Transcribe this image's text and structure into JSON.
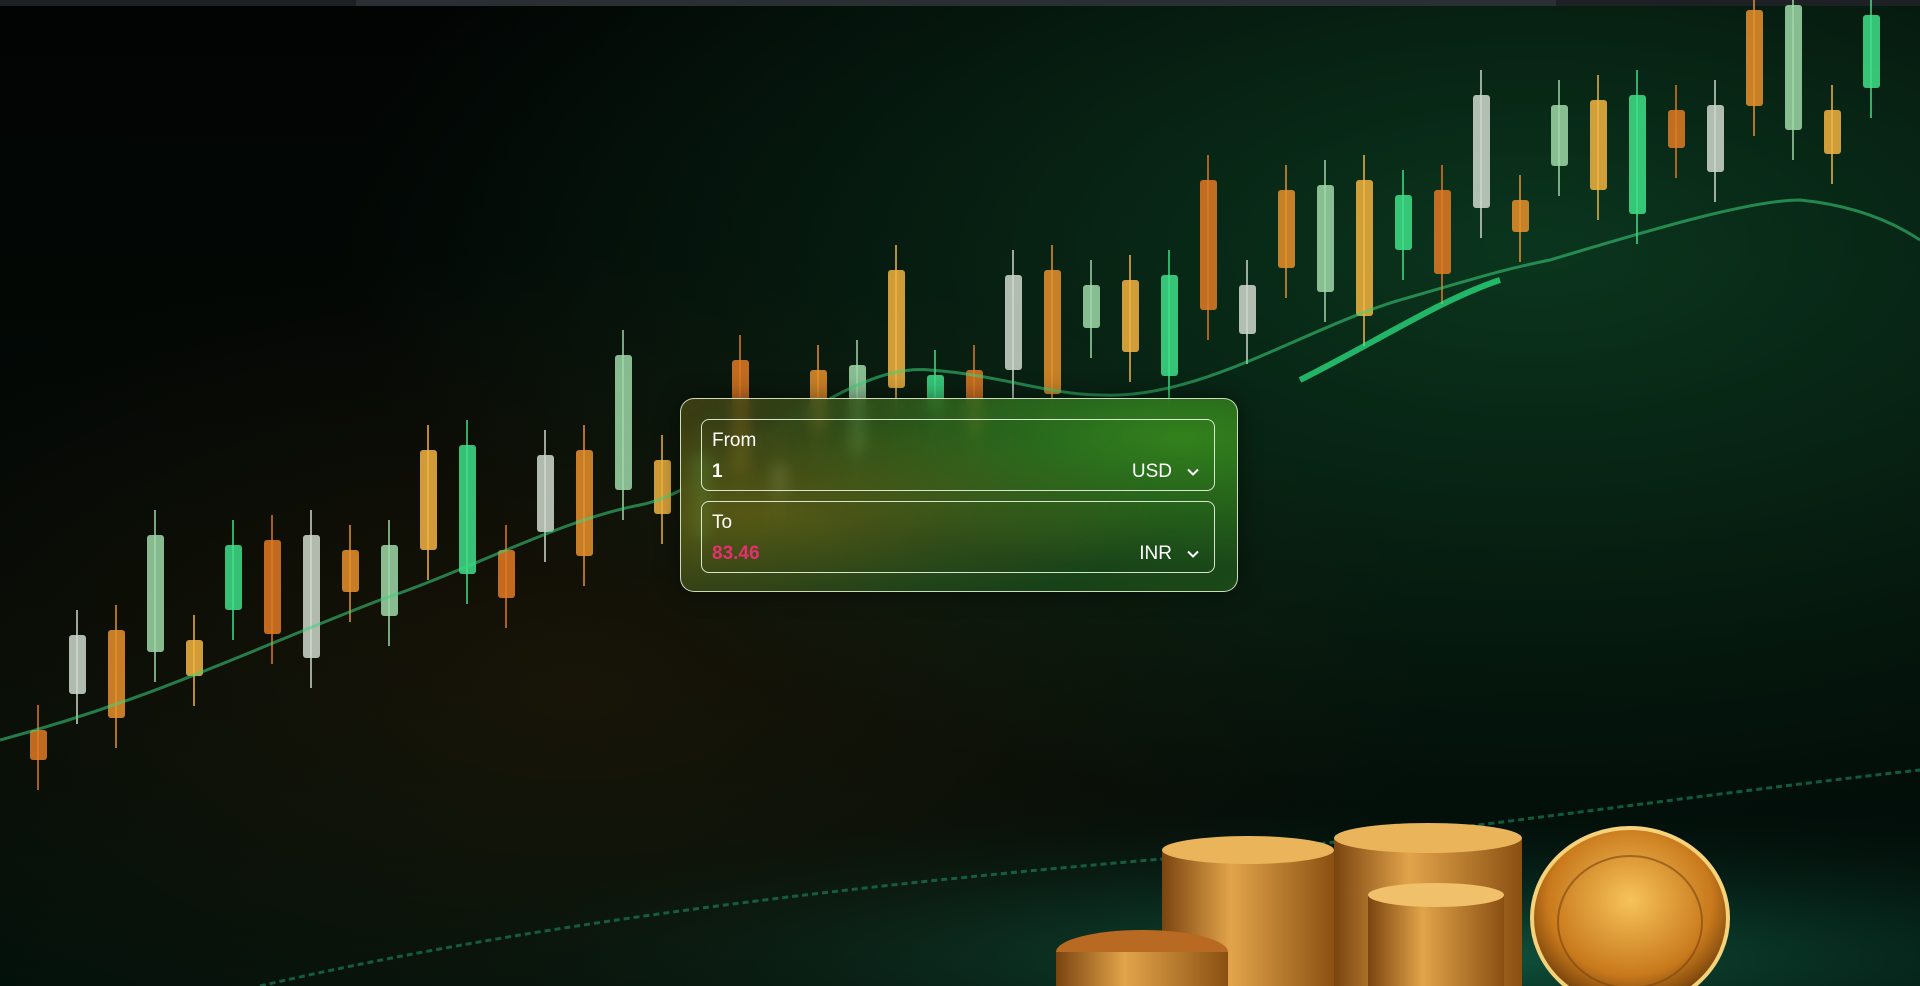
{
  "converter": {
    "from": {
      "label": "From",
      "value": "1",
      "currency": "USD"
    },
    "to": {
      "label": "To",
      "value": "83.46",
      "currency": "INR"
    }
  },
  "icons": {
    "dropdown": "chevron-down-icon"
  },
  "colors": {
    "result_value": "#e6306d",
    "panel_border": "#ebf5d7"
  }
}
